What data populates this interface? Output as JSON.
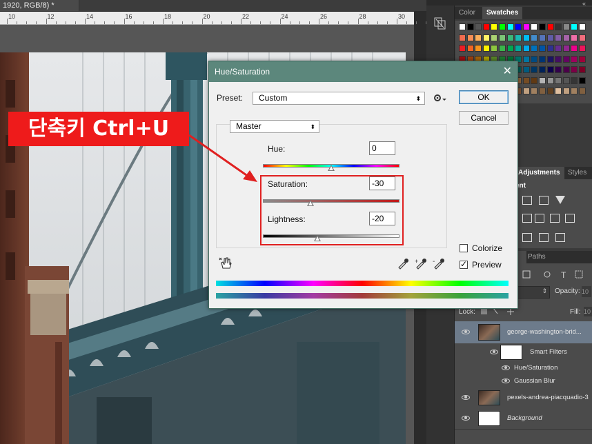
{
  "document": {
    "tab_title": "1920, RGB/8) *"
  },
  "ruler": {
    "labels": [
      "10",
      "12",
      "14",
      "16",
      "18",
      "20",
      "22",
      "24",
      "26",
      "28",
      "30"
    ]
  },
  "panels": {
    "color_tab": "Color",
    "swatches_tab": "Swatches",
    "adjustments_tab": "Adjustments",
    "styles_tab": "Styles",
    "adjustments_heading": "ent",
    "paths_tab": "Paths",
    "opacity_label": "Opacity:",
    "opacity_value": "10",
    "fill_label": "Fill:",
    "fill_value": "10",
    "lock_label": "Lock:"
  },
  "layers": [
    {
      "name": "george-washington-brid...",
      "selected": true,
      "thumb": "photo"
    },
    {
      "name": "Smart Filters",
      "selected": false,
      "thumb": "white"
    },
    {
      "name": "Hue/Saturation",
      "selected": false,
      "thumb": "none"
    },
    {
      "name": "Gaussian Blur",
      "selected": false,
      "thumb": "none"
    },
    {
      "name": "pexels-andrea-piacquadio-3",
      "selected": false,
      "thumb": "photo"
    },
    {
      "name": "Background",
      "selected": false,
      "thumb": "white"
    }
  ],
  "dialog": {
    "title": "Hue/Saturation",
    "close": "✕",
    "preset_label": "Preset:",
    "preset_value": "Custom",
    "channel_value": "Master",
    "ok": "OK",
    "cancel": "Cancel",
    "hue_label": "Hue:",
    "hue_value": "0",
    "saturation_label": "Saturation:",
    "saturation_value": "-30",
    "lightness_label": "Lightness:",
    "lightness_value": "-20",
    "colorize_label": "Colorize",
    "preview_label": "Preview",
    "colorize_checked": false,
    "preview_checked": true,
    "slider_positions": {
      "hue": 0.5,
      "saturation": 0.35,
      "lightness": 0.4
    }
  },
  "annotation": {
    "shortcut": "단축키 Ctrl+U",
    "box_color": "#e02020",
    "label_bg": "#ee1b1b"
  },
  "colors": {
    "dialog_title_bg": "#5c877c",
    "panel_bg": "#4b4b4b",
    "selected_layer": "#6d7b8b"
  }
}
